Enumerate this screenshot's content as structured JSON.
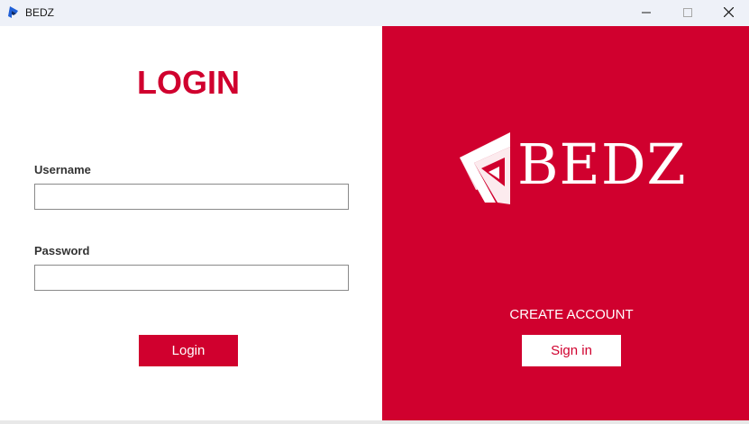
{
  "window": {
    "title": "BEDZ",
    "controls": {
      "minimize": "minimize-icon",
      "maximize": "maximize-icon",
      "close": "close-icon"
    }
  },
  "login": {
    "heading": "LOGIN",
    "username_label": "Username",
    "username_value": "",
    "password_label": "Password",
    "password_value": "",
    "button_label": "Login"
  },
  "brand": {
    "logo_text": "BEDZ",
    "logo_icon": "bedz-logo-icon"
  },
  "signup": {
    "prompt": "CREATE ACCOUNT",
    "button_label": "Sign in"
  },
  "colors": {
    "accent": "#d0002e",
    "titlebar": "#eef1f8",
    "panel_left": "#ffffff",
    "text_dark": "#333333"
  }
}
